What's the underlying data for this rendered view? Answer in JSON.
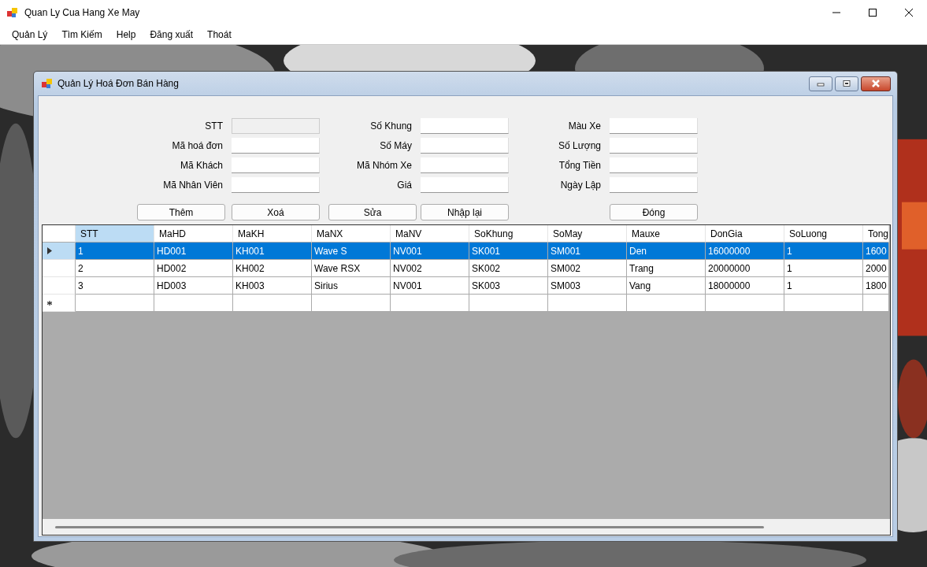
{
  "window": {
    "title": "Quan Ly Cua Hang Xe May"
  },
  "menu": [
    "Quản Lý",
    "Tìm Kiếm",
    "Help",
    "Đăng xuất",
    "Thoát"
  ],
  "child_window": {
    "title": "Quản Lý Hoá Đơn Bán Hàng",
    "fields": [
      {
        "label": "STT",
        "disabled": true
      },
      {
        "label": "Số Khung",
        "disabled": false
      },
      {
        "label": "Màu Xe",
        "disabled": false
      },
      {
        "label": "Mã hoá đơn",
        "disabled": false
      },
      {
        "label": "Số Máy",
        "disabled": false
      },
      {
        "label": "Số Lượng",
        "disabled": false
      },
      {
        "label": "Mã Khách",
        "disabled": false
      },
      {
        "label": "Mã Nhóm Xe",
        "disabled": false
      },
      {
        "label": "Tổng Tiền",
        "disabled": false
      },
      {
        "label": "Mã Nhân Viên",
        "disabled": false
      },
      {
        "label": "Giá",
        "disabled": false
      },
      {
        "label": "Ngày Lập",
        "disabled": false
      }
    ],
    "buttons": [
      "Thêm",
      "Xoá",
      "Sửa",
      "Nhập lại",
      "Đóng"
    ],
    "grid": {
      "columns": [
        {
          "label": "STT",
          "selected": true
        },
        {
          "label": "MaHD",
          "selected": false
        },
        {
          "label": "MaKH",
          "selected": false
        },
        {
          "label": "MaNX",
          "selected": false
        },
        {
          "label": "MaNV",
          "selected": false
        },
        {
          "label": "SoKhung",
          "selected": false
        },
        {
          "label": "SoMay",
          "selected": false
        },
        {
          "label": "Mauxe",
          "selected": false
        },
        {
          "label": "DonGia",
          "selected": false
        },
        {
          "label": "SoLuong",
          "selected": false
        },
        {
          "label": "Tong",
          "selected": false
        }
      ],
      "rows": [
        {
          "selected": true,
          "cells": [
            "1",
            "HD001",
            "KH001",
            "Wave S",
            "NV001",
            "SK001",
            "SM001",
            "Den",
            "16000000",
            "1",
            "1600"
          ]
        },
        {
          "selected": false,
          "cells": [
            "2",
            "HD002",
            "KH002",
            "Wave RSX",
            "NV002",
            "SK002",
            "SM002",
            "Trang",
            "20000000",
            "1",
            "2000"
          ]
        },
        {
          "selected": false,
          "cells": [
            "3",
            "HD003",
            "KH003",
            "Sirius",
            "NV001",
            "SK003",
            "SM003",
            "Vang",
            "18000000",
            "1",
            "1800"
          ]
        }
      ]
    }
  }
}
